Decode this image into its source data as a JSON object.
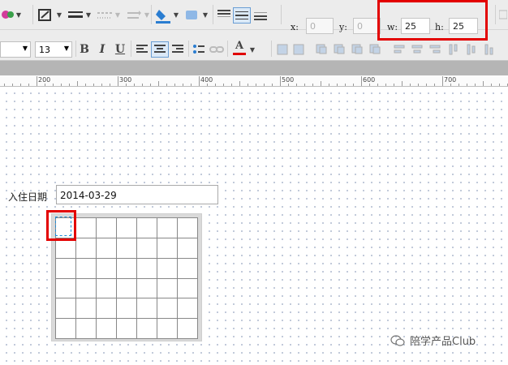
{
  "toolbar": {
    "font_size": "13",
    "bold": "B",
    "italic": "I",
    "underline": "U",
    "font_color_glyph": "A",
    "x_label": "x:",
    "x_value": "0",
    "y_label": "y:",
    "y_value": "0",
    "w_label": "w:",
    "w_value": "25",
    "h_label": "h:",
    "h_value": "25"
  },
  "ruler": {
    "labels": [
      "200",
      "300",
      "400",
      "500",
      "600",
      "700"
    ]
  },
  "form": {
    "label": "入住日期",
    "date_value": "2014-03-29"
  },
  "calendar": {
    "rows": 6,
    "cols": 7
  },
  "watermark": {
    "text": "陪学产品Club"
  },
  "colors": {
    "highlight": "#e30000",
    "selection": "#1e8bd6",
    "font_color_bar": "#e00000"
  }
}
